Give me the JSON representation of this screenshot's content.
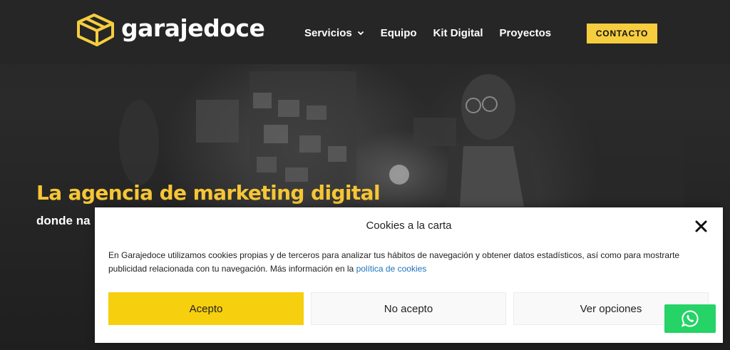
{
  "brand": {
    "name": "garajedoce",
    "logo_icon": "cube-logo-icon",
    "accent": "#f6cd3f"
  },
  "nav": {
    "items": [
      {
        "label": "Servicios",
        "has_dropdown": true
      },
      {
        "label": "Equipo"
      },
      {
        "label": "Kit Digital"
      },
      {
        "label": "Proyectos"
      }
    ],
    "cta_label": "CONTACTO"
  },
  "hero": {
    "headline": "La agencia de marketing digital",
    "subline": "donde na"
  },
  "cookie_modal": {
    "title": "Cookies a la carta",
    "text": "En Garajedoce utilizamos cookies propias y de terceros para analizar tus hábitos de navegación y obtener datos estadísticos, así como para mostrarte publicidad relacionada con tu navegación. Más información en la ",
    "link_text": "política de cookies",
    "accept_label": "Acepto",
    "deny_label": "No acepto",
    "options_label": "Ver opciones",
    "accept_color": "#f6cf0e"
  },
  "whatsapp": {
    "icon": "whatsapp-icon",
    "color": "#25d366"
  }
}
